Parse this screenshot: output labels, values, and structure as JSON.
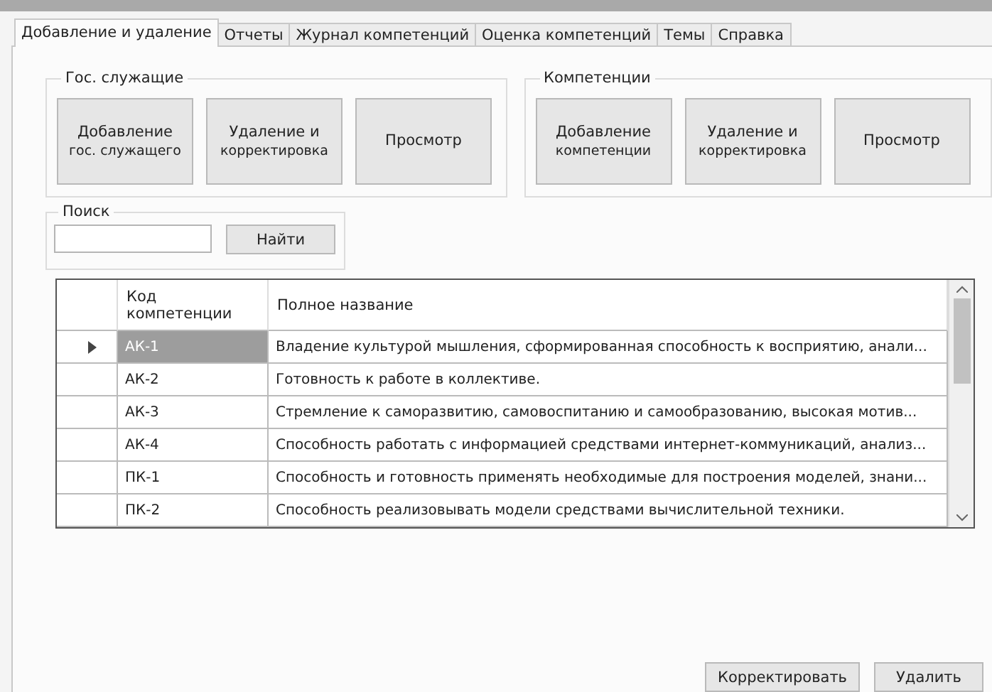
{
  "tabs": [
    {
      "label": "Добавление и удаление",
      "selected": true
    },
    {
      "label": "Отчеты",
      "selected": false
    },
    {
      "label": "Журнал компетенций",
      "selected": false
    },
    {
      "label": "Оценка компетенций",
      "selected": false
    },
    {
      "label": "Темы",
      "selected": false
    },
    {
      "label": "Справка",
      "selected": false
    }
  ],
  "groups": [
    {
      "title": "Гос. служащие",
      "buttons": [
        [
          "Добавление",
          "гос. служащего"
        ],
        [
          "Удаление и",
          "корректировка"
        ],
        [
          "Просмотр"
        ]
      ]
    },
    {
      "title": "Компетенции",
      "buttons": [
        [
          "Добавление",
          "компетенции"
        ],
        [
          "Удаление и",
          "корректировка"
        ],
        [
          "Просмотр"
        ]
      ]
    }
  ],
  "search": {
    "title": "Поиск",
    "button": "Найти"
  },
  "table": {
    "columns": [
      "Код компетенции",
      "Полное название"
    ],
    "rows": [
      {
        "selected": true,
        "cells": [
          "АК-1",
          "Владение культурой мышления, сформированная способность к восприятию, анали..."
        ]
      },
      {
        "selected": false,
        "cells": [
          "АК-2",
          "Готовность к работе в коллективе."
        ]
      },
      {
        "selected": false,
        "cells": [
          "АК-3",
          "Стремление к саморазвитию, самовоспитанию и самообразованию, высокая мотив..."
        ]
      },
      {
        "selected": false,
        "cells": [
          "АК-4",
          "Способность работать с информацией средствами интернет-коммуникаций, анализ..."
        ]
      },
      {
        "selected": false,
        "cells": [
          "ПК-1",
          "Способность и готовность применять необходимые для построения моделей, знани..."
        ]
      },
      {
        "selected": false,
        "cells": [
          "ПК-2",
          "Способность реализовывать модели средствами вычислительной техники."
        ]
      }
    ]
  },
  "buttons": [
    "Корректировать",
    "Удалить"
  ]
}
